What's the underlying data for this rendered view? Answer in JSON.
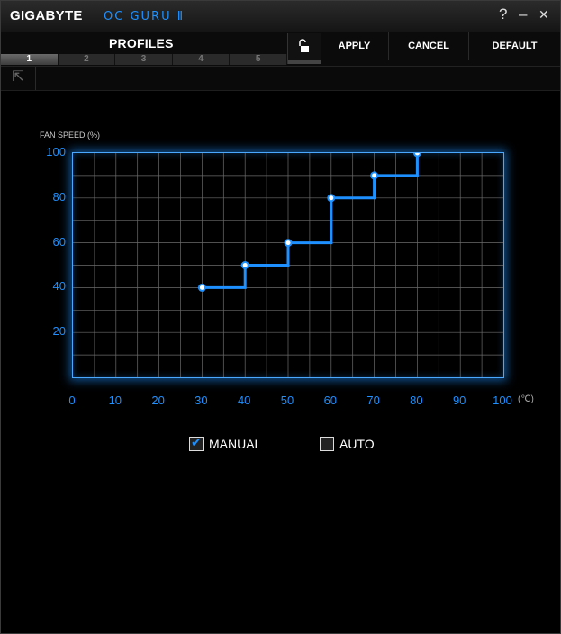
{
  "window": {
    "brand": "GIGABYTE",
    "product": "OC GURU Ⅱ",
    "help": "?",
    "minimize": "–",
    "close": "✕"
  },
  "toolbar": {
    "profiles_label": "PROFILES",
    "tabs": [
      "1",
      "2",
      "3",
      "4",
      "5"
    ],
    "active_tab": "1",
    "lock_icon": "unlock-icon",
    "apply": "APPLY",
    "cancel": "CANCEL",
    "default": "DEFAULT"
  },
  "subbar": {
    "back_icon": "arrow-up-left-icon",
    "back_glyph": "⇱"
  },
  "chart_data": {
    "type": "line",
    "step": true,
    "ylabel": "FAN SPEED (%)",
    "xunit": "(℃)",
    "xlim": [
      0,
      100
    ],
    "ylim": [
      0,
      100
    ],
    "xticks": [
      "0",
      "10",
      "20",
      "30",
      "40",
      "50",
      "60",
      "70",
      "80",
      "90",
      "100"
    ],
    "yticks": [
      "100",
      "80",
      "60",
      "40",
      "20"
    ],
    "grid": true,
    "colors": {
      "line": "#1e90ff",
      "grid": "#6b6b6b",
      "border": "#4aa8ff"
    },
    "points": [
      {
        "x": 30,
        "y": 40
      },
      {
        "x": 40,
        "y": 50
      },
      {
        "x": 50,
        "y": 60
      },
      {
        "x": 60,
        "y": 80
      },
      {
        "x": 70,
        "y": 90
      },
      {
        "x": 80,
        "y": 100
      }
    ]
  },
  "mode": {
    "manual": {
      "label": "MANUAL",
      "checked": true
    },
    "auto": {
      "label": "AUTO",
      "checked": false
    }
  }
}
